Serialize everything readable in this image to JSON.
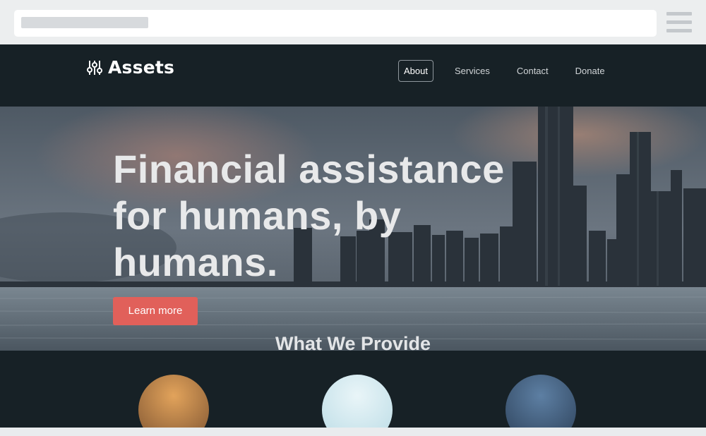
{
  "browser": {
    "menu_icon": "hamburger-menu-icon"
  },
  "site": {
    "brand": {
      "name": "Assets",
      "icon": "sliders-icon"
    },
    "nav": [
      {
        "label": "About",
        "active": true
      },
      {
        "label": "Services",
        "active": false
      },
      {
        "label": "Contact",
        "active": false
      },
      {
        "label": "Donate",
        "active": false
      }
    ],
    "hero": {
      "title": "Financial assistance for humans, by humans.",
      "cta_label": "Learn more"
    },
    "section": {
      "title": "What We Provide"
    },
    "colors": {
      "background": "#172126",
      "accent": "#e1605a",
      "text_light": "#e8e9ea"
    }
  }
}
